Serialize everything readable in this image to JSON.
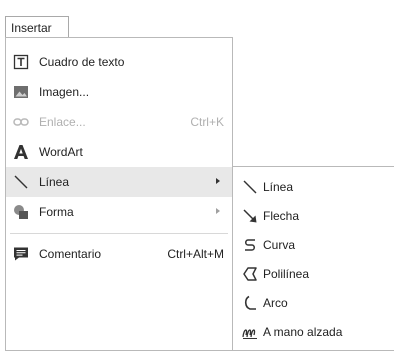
{
  "menubar": {
    "insert_label": "Insertar"
  },
  "menu": {
    "items": [
      {
        "label": "Cuadro de texto",
        "icon": "text-box-icon"
      },
      {
        "label": "Imagen...",
        "icon": "image-icon"
      },
      {
        "label": "Enlace...",
        "shortcut": "Ctrl+K",
        "icon": "link-icon",
        "disabled": true
      },
      {
        "label": "WordArt",
        "icon": "wordart-icon"
      },
      {
        "label": "Línea",
        "icon": "line-icon",
        "has_submenu": true,
        "active": true
      },
      {
        "label": "Forma",
        "icon": "shape-icon",
        "has_submenu": true
      },
      {
        "label": "Comentario",
        "shortcut": "Ctrl+Alt+M",
        "icon": "comment-icon"
      }
    ]
  },
  "submenu": {
    "items": [
      {
        "label": "Línea",
        "icon": "line-icon"
      },
      {
        "label": "Flecha",
        "icon": "arrow-icon"
      },
      {
        "label": "Curva",
        "icon": "curve-icon"
      },
      {
        "label": "Polilínea",
        "icon": "polyline-icon"
      },
      {
        "label": "Arco",
        "icon": "arc-icon"
      },
      {
        "label": "A mano alzada",
        "icon": "freehand-icon"
      }
    ]
  }
}
